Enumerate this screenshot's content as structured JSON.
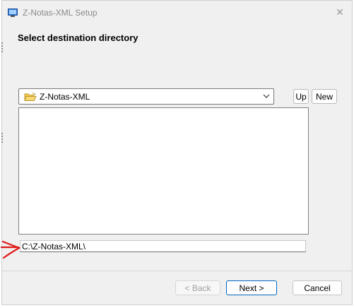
{
  "window": {
    "title": "Z-Notas-XML Setup",
    "close_glyph": "✕"
  },
  "header": {
    "heading": "Select destination directory"
  },
  "directory": {
    "selected_folder": "Z-Notas-XML",
    "up_label": "Up",
    "new_label": "New",
    "items": []
  },
  "path": {
    "value": "C:\\Z-Notas-XML\\"
  },
  "footer": {
    "back_label": "< Back",
    "next_label": "Next >",
    "cancel_label": "Cancel"
  },
  "colors": {
    "annotation": "#e01b1b",
    "default_button_border": "#0067c0",
    "folder_icon": "#f2c94c"
  },
  "icons": {
    "app": "setup-app-icon",
    "folder": "open-folder-icon",
    "dropdown": "chevron-down-icon",
    "annotation": "red-arrow-annotation"
  }
}
